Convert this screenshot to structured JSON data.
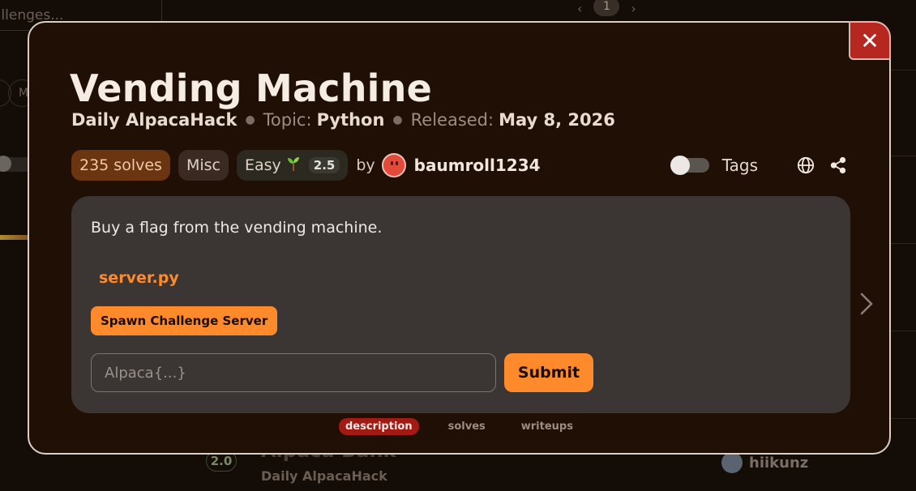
{
  "background": {
    "search_text": "allenges...",
    "page_prev": "‹",
    "page_current": "1",
    "page_next": "›",
    "pill_label": "M",
    "bottom_row": {
      "level": "2.0",
      "title": "Alpaca Bank",
      "subtitle": "Daily AlpacaHack",
      "author": "hiikunz"
    }
  },
  "modal": {
    "close_label": "✕",
    "title": "Vending Machine",
    "meta": {
      "series": "Daily AlpacaHack",
      "topic_label": "Topic:",
      "topic": "Python",
      "released_label": "Released:",
      "released": "May 8, 2026"
    },
    "badges": {
      "solves": "235 solves",
      "category": "Misc",
      "difficulty": "Easy",
      "difficulty_score": "2.5"
    },
    "by_label": "by",
    "author": "baumroll1234",
    "tags_label": "Tags",
    "description": "Buy a flag from the vending machine.",
    "file_link": "server.py",
    "spawn_label": "Spawn Challenge Server",
    "flag_placeholder": "Alpaca{...}",
    "submit_label": "Submit",
    "tabs": [
      {
        "label": "description",
        "active": true
      },
      {
        "label": "solves",
        "active": false
      },
      {
        "label": "writeups",
        "active": false
      }
    ]
  },
  "colors": {
    "accent": "#ff8a2b",
    "close_red": "#b5271f",
    "panel": "#3b3533",
    "modal_bg": "#200f05"
  },
  "icons": {
    "close": "close-icon",
    "globe": "globe-icon",
    "share": "share-icon",
    "next": "chevron-right-icon",
    "sprout": "sprout-icon"
  }
}
